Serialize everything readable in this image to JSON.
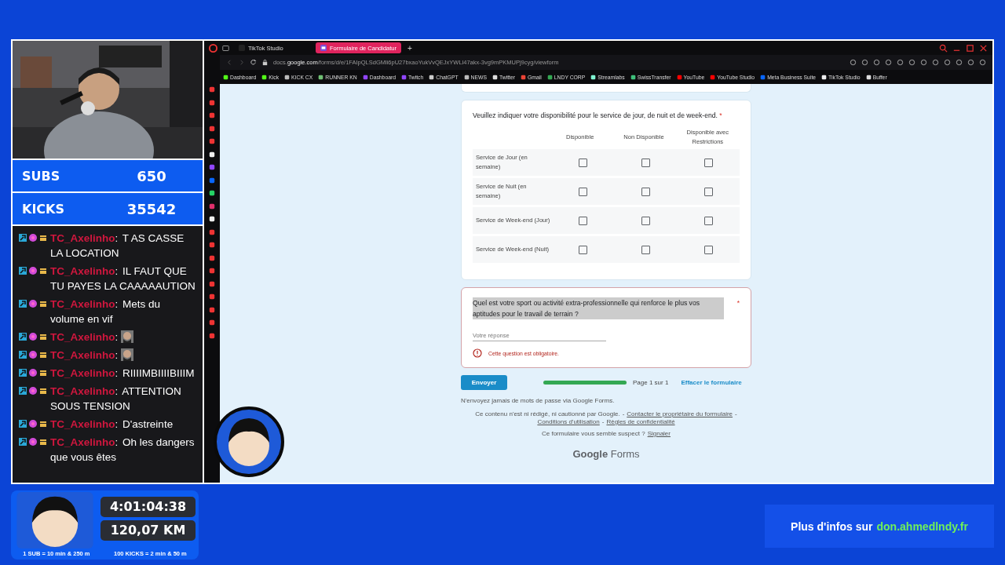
{
  "counters": [
    {
      "label": "SUBS",
      "value": "650"
    },
    {
      "label": "KICKS",
      "value": "35542"
    }
  ],
  "chat": [
    {
      "user": "TC_Axelinho",
      "separator": ":",
      "kind": "text",
      "message": "T AS CASSE LA LOCATION"
    },
    {
      "user": "TC_Axelinho",
      "separator": ":",
      "kind": "text",
      "message": "IL FAUT QUE TU PAYES LA CAAAAAUTION"
    },
    {
      "user": "TC_Axelinho",
      "separator": ":",
      "kind": "text",
      "message": "Mets du volume en vif"
    },
    {
      "user": "TC_Axelinho",
      "separator": ":",
      "kind": "emote"
    },
    {
      "user": "TC_Axelinho",
      "separator": ":",
      "kind": "emote"
    },
    {
      "user": "TC_Axelinho",
      "separator": ":",
      "kind": "text",
      "message": "RIIIIMBIIIIBIIIM"
    },
    {
      "user": "TC_Axelinho",
      "separator": ":",
      "kind": "text",
      "message": "ATTENTION SOUS TENSION"
    },
    {
      "user": "TC_Axelinho",
      "separator": ":",
      "kind": "text",
      "message": "D'astreinte"
    },
    {
      "user": "TC_Axelinho",
      "separator": ":",
      "kind": "text",
      "message": "Oh les dangers que vous êtes"
    }
  ],
  "browser": {
    "tabs": [
      {
        "label": "TikTok Studio",
        "selected": false
      },
      {
        "label": "Formulaire de Candidatur",
        "selected": true
      }
    ],
    "new_tab": "+",
    "url": "docs.**google.com**/forms/d/e/1FAIpQLSdGMli6pU27bxaoYukVvQEJxYWLl47akx-3vg9mPKMUPj9cyg/viewform",
    "bookmarks": [
      {
        "label": "Dashboard",
        "color": "#53fc18"
      },
      {
        "label": "Kick",
        "color": "#53fc18"
      },
      {
        "label": "KICK CX",
        "color": "#bbbbbb"
      },
      {
        "label": "RUNNER KN",
        "color": "#6fbf73"
      },
      {
        "label": "Dashboard",
        "color": "#9146ff"
      },
      {
        "label": "Twitch",
        "color": "#9146ff"
      },
      {
        "label": "ChatGPT",
        "color": "#cccccc"
      },
      {
        "label": "NEWS",
        "color": "#bbbbbb"
      },
      {
        "label": "Twitter",
        "color": "#dddddd"
      },
      {
        "label": "Gmail",
        "color": "#ea4335"
      },
      {
        "label": "LNDY CORP",
        "color": "#34a853"
      },
      {
        "label": "Streamlabs",
        "color": "#80f5d2"
      },
      {
        "label": "SwissTransfer",
        "color": "#3ebf7a"
      },
      {
        "label": "YouTube",
        "color": "#ff0000"
      },
      {
        "label": "YouTube Studio",
        "color": "#ff0000"
      },
      {
        "label": "Meta Business Suite",
        "color": "#0866ff"
      },
      {
        "label": "TikTok Studio",
        "color": "#eeeeee"
      },
      {
        "label": "Buffer",
        "color": "#dddddd"
      }
    ]
  },
  "form": {
    "grid_question": {
      "text": "Veuillez indiquer votre disponibilité pour le service de jour, de nuit et de week-end.",
      "required": "*",
      "columns": [
        "Disponible",
        "Non Disponible",
        "Disponible avec Restrictions"
      ],
      "rows": [
        {
          "label": "Service de Jour (en semaine)",
          "checked": [
            false,
            false,
            false
          ]
        },
        {
          "label": "Service de Nuit (en semaine)",
          "checked": [
            false,
            false,
            false
          ]
        },
        {
          "label": "Service de Week-end (Jour)",
          "checked": [
            false,
            false,
            false
          ]
        },
        {
          "label": "Service de Week-end (Nuit)",
          "checked": [
            false,
            false,
            false
          ]
        }
      ]
    },
    "text_question": {
      "text": "Quel est votre sport ou activité extra-professionnelle qui renforce le plus vos aptitudes pour le travail de terrain ?",
      "required": "*",
      "placeholder": "Votre réponse",
      "error": "Cette question est obligatoire."
    },
    "submit": "Envoyer",
    "progress": {
      "level": 1.0,
      "label": "Page 1 sur 1"
    },
    "clear": "Effacer le formulaire",
    "password_note": "N'envoyez jamais de mots de passe via Google Forms.",
    "disclaimer": "Ce contenu n'est ni rédigé, ni cautionné par Google.",
    "separator": "-",
    "links": [
      "Contacter le propriétaire du formulaire",
      "Conditions d'utilisation",
      "Règles de confidentialité"
    ],
    "suspect": "Ce formulaire vous semble suspect ?",
    "report": "Signaler",
    "logo": [
      "Google",
      "Forms"
    ]
  },
  "timer": {
    "time": "4:01:04:38",
    "distance": "120,07 KM",
    "rules": [
      "1 SUB = 10 min & 250 m",
      "100 KICKS = 2 min & 50 m"
    ]
  },
  "banner": {
    "prefix": "Plus d'infos sur",
    "link": "don.ahmedlndy.fr"
  }
}
